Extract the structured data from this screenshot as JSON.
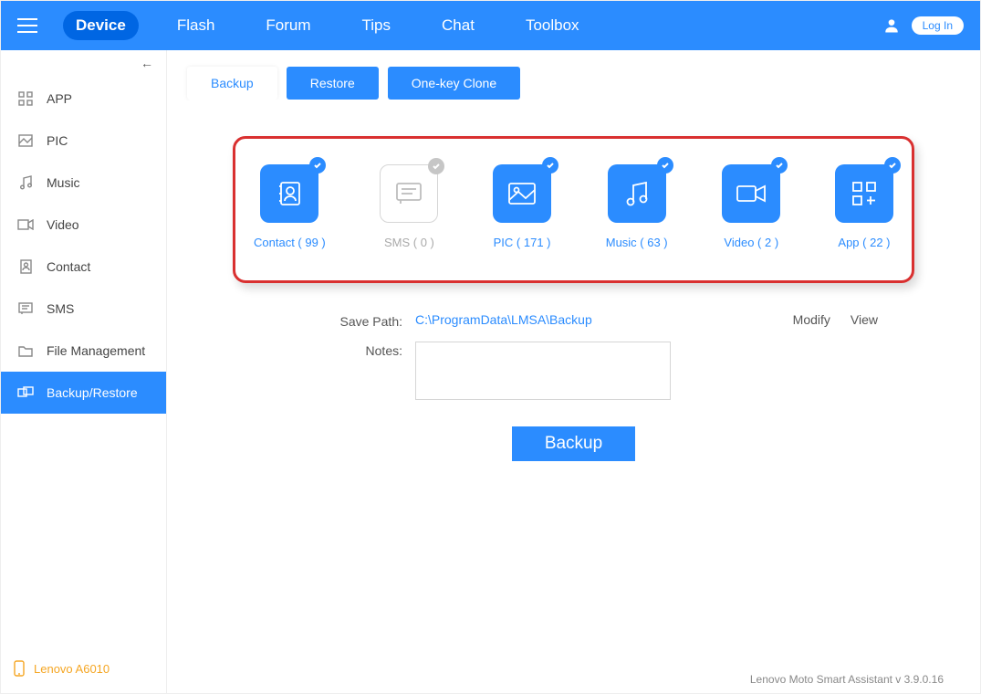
{
  "nav": {
    "items": [
      "Device",
      "Flash",
      "Forum",
      "Tips",
      "Chat",
      "Toolbox"
    ],
    "active_index": 0,
    "login_label": "Log In"
  },
  "sidebar": {
    "items": [
      {
        "label": "APP"
      },
      {
        "label": "PIC"
      },
      {
        "label": "Music"
      },
      {
        "label": "Video"
      },
      {
        "label": "Contact"
      },
      {
        "label": "SMS"
      },
      {
        "label": "File Management"
      },
      {
        "label": "Backup/Restore"
      }
    ],
    "active_index": 7,
    "device_name": "Lenovo A6010"
  },
  "tabs": {
    "backup": "Backup",
    "restore": "Restore",
    "clone": "One-key Clone"
  },
  "tiles": [
    {
      "label": "Contact ( 99 )",
      "selected": true
    },
    {
      "label": "SMS ( 0 )",
      "selected": false
    },
    {
      "label": "PIC ( 171 )",
      "selected": true
    },
    {
      "label": "Music ( 63 )",
      "selected": true
    },
    {
      "label": "Video ( 2 )",
      "selected": true
    },
    {
      "label": "App ( 22 )",
      "selected": true
    }
  ],
  "form": {
    "save_path_label": "Save Path:",
    "save_path_value": "C:\\ProgramData\\LMSA\\Backup",
    "modify_label": "Modify",
    "view_label": "View",
    "notes_label": "Notes:",
    "notes_value": ""
  },
  "backup_button": "Backup",
  "footer": "Lenovo Moto Smart Assistant v 3.9.0.16"
}
